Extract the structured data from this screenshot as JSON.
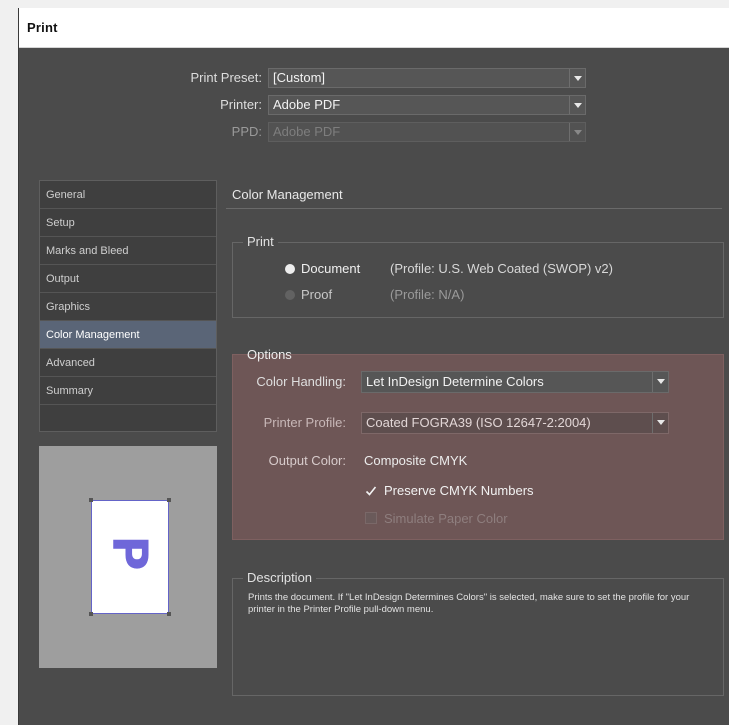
{
  "window": {
    "title": "Print"
  },
  "top": {
    "preset_label": "Print Preset:",
    "preset_value": "[Custom]",
    "printer_label": "Printer:",
    "printer_value": "Adobe PDF",
    "ppd_label": "PPD:",
    "ppd_value": "Adobe PDF"
  },
  "sidebar": {
    "items": [
      {
        "label": "General"
      },
      {
        "label": "Setup"
      },
      {
        "label": "Marks and Bleed"
      },
      {
        "label": "Output"
      },
      {
        "label": "Graphics"
      },
      {
        "label": "Color Management"
      },
      {
        "label": "Advanced"
      },
      {
        "label": "Summary"
      }
    ],
    "active_index": 5
  },
  "preview": {
    "glyph": "P"
  },
  "main": {
    "section_title": "Color Management",
    "print_group": {
      "title": "Print",
      "document_label": "Document",
      "document_profile": "(Profile: U.S. Web Coated (SWOP) v2)",
      "proof_label": "Proof",
      "proof_profile": "(Profile: N/A)",
      "selected": "Document"
    },
    "options": {
      "title": "Options",
      "color_handling_label": "Color Handling:",
      "color_handling_value": "Let InDesign Determine Colors",
      "printer_profile_label": "Printer Profile:",
      "printer_profile_value": "Coated FOGRA39 (ISO 12647-2:2004)",
      "output_color_label": "Output Color:",
      "output_color_value": "Composite CMYK",
      "preserve_cmyk_label": "Preserve CMYK Numbers",
      "preserve_cmyk_checked": true,
      "simulate_paper_label": "Simulate Paper Color",
      "simulate_paper_checked": false,
      "highlight_color": "#6e5656"
    },
    "description": {
      "title": "Description",
      "text": "Prints the document. If \"Let InDesign Determines Colors\" is selected, make sure to set the profile for your printer in the Printer Profile pull-down menu."
    }
  },
  "colors": {
    "dialog_bg": "#4b4b4b",
    "active_item": "#5a6577",
    "preview_bg": "#9e9e9e",
    "page_glyph": "#6f67d9"
  }
}
